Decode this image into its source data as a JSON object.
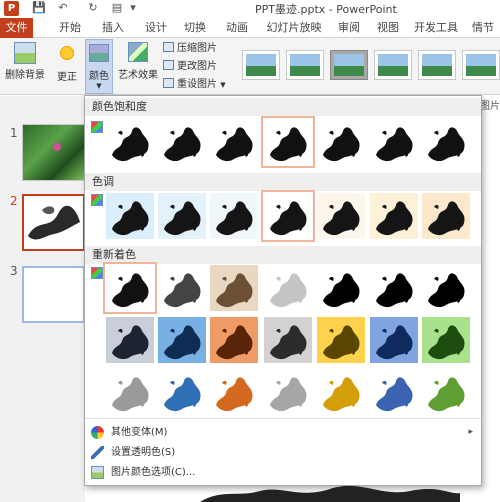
{
  "window": {
    "title": "PPT墨迹.pptx - PowerPoint",
    "app_badge": "P"
  },
  "qat": [
    "save-icon",
    "undo-icon",
    "redo-icon",
    "start-from-beginning-icon",
    "customize-qat-icon"
  ],
  "tabs": [
    {
      "label": "文件"
    },
    {
      "label": "开始"
    },
    {
      "label": "插入"
    },
    {
      "label": "设计"
    },
    {
      "label": "切换"
    },
    {
      "label": "动画"
    },
    {
      "label": "幻灯片放映"
    },
    {
      "label": "审阅"
    },
    {
      "label": "视图"
    },
    {
      "label": "开发工具"
    },
    {
      "label": "情节"
    }
  ],
  "ribbon": {
    "remove_bg": "删除背景",
    "corrections": "更正",
    "color": "颜色",
    "artistic": "艺术效果",
    "compress": "压缩图片",
    "change": "更改图片",
    "reset": "重设图片",
    "styles_label": "图片样"
  },
  "slides": [
    {
      "num": "1"
    },
    {
      "num": "2"
    },
    {
      "num": "3"
    }
  ],
  "color_menu": {
    "saturation_header": "颜色饱和度",
    "tone_header": "色调",
    "recolor_header": "重新着色",
    "saturation_tints": [
      "#ffffff",
      "#ffffff",
      "#ffffff",
      "#ffffff",
      "#ffffff",
      "#ffffff",
      "#ffffff"
    ],
    "tone_tints": [
      "#dbeefc",
      "#e3f1fb",
      "#f0f7fb",
      "#ffffff",
      "#fcf7ea",
      "#fdf2d8",
      "#fde8cc"
    ],
    "recolor_rows": [
      [
        {
          "bg": "#ffffff",
          "ink": "#111111"
        },
        {
          "bg": "#ffffff",
          "ink": "#444444"
        },
        {
          "bg": "#ead7c2",
          "ink": "#6b5035"
        },
        {
          "bg": "#ffffff",
          "ink": "#c4c4c4"
        },
        {
          "bg": "#ffffff",
          "ink": "#000000"
        },
        {
          "bg": "#ffffff",
          "ink": "#000000"
        },
        {
          "bg": "#ffffff",
          "ink": "#000000"
        }
      ],
      [
        {
          "bg": "#c9ced8",
          "ink": "#1d2330"
        },
        {
          "bg": "#79b0e4",
          "ink": "#0f2d52"
        },
        {
          "bg": "#f09a65",
          "ink": "#5a2408"
        },
        {
          "bg": "#d2d2d2",
          "ink": "#2c2c2c"
        },
        {
          "bg": "#ffd24d",
          "ink": "#5a4600"
        },
        {
          "bg": "#7fa4e0",
          "ink": "#0f2a5e"
        },
        {
          "bg": "#a9e28c",
          "ink": "#1d4d0e"
        }
      ],
      [
        {
          "bg": "#ffffff",
          "ink": "#9a9a9a"
        },
        {
          "bg": "#ffffff",
          "ink": "#2e6fb5"
        },
        {
          "bg": "#ffffff",
          "ink": "#d2691e"
        },
        {
          "bg": "#ffffff",
          "ink": "#a6a6a6"
        },
        {
          "bg": "#ffffff",
          "ink": "#d49e0a"
        },
        {
          "bg": "#ffffff",
          "ink": "#3b63b2"
        },
        {
          "bg": "#ffffff",
          "ink": "#5e9e32"
        }
      ]
    ],
    "more_variations": "其他变体(M)",
    "set_transparent": "设置透明色(S)",
    "picture_color_options": "图片颜色选项(C)..."
  }
}
